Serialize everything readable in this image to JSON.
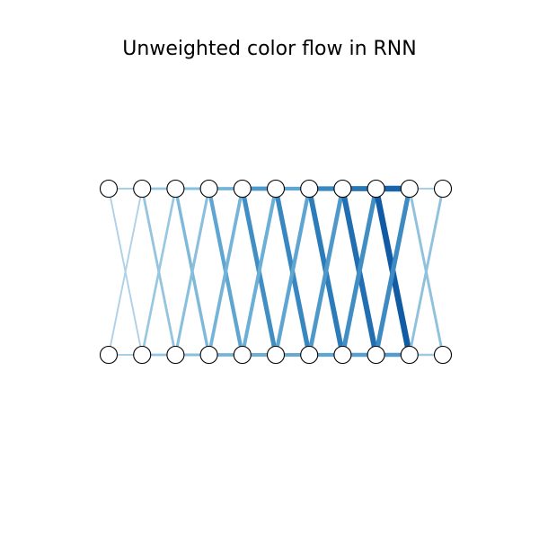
{
  "title": "Unweighted color flow in RNN",
  "diagram": {
    "node_count_per_row": 11,
    "rows": [
      "top",
      "bottom"
    ],
    "node_fill": "#ffffff",
    "node_stroke": "#000000",
    "colormap": "Blues",
    "edges": [
      {
        "from": [
          "top",
          0
        ],
        "to": [
          "top",
          1
        ],
        "level": 0.18
      },
      {
        "from": [
          "top",
          1
        ],
        "to": [
          "top",
          2
        ],
        "level": 0.28
      },
      {
        "from": [
          "top",
          2
        ],
        "to": [
          "top",
          3
        ],
        "level": 0.35
      },
      {
        "from": [
          "top",
          3
        ],
        "to": [
          "top",
          4
        ],
        "level": 0.45
      },
      {
        "from": [
          "top",
          4
        ],
        "to": [
          "top",
          5
        ],
        "level": 0.62
      },
      {
        "from": [
          "top",
          5
        ],
        "to": [
          "top",
          6
        ],
        "level": 0.55
      },
      {
        "from": [
          "top",
          6
        ],
        "to": [
          "top",
          7
        ],
        "level": 0.72
      },
      {
        "from": [
          "top",
          7
        ],
        "to": [
          "top",
          8
        ],
        "level": 0.8
      },
      {
        "from": [
          "top",
          8
        ],
        "to": [
          "top",
          9
        ],
        "level": 0.9
      },
      {
        "from": [
          "top",
          9
        ],
        "to": [
          "top",
          10
        ],
        "level": 0.18
      },
      {
        "from": [
          "bottom",
          0
        ],
        "to": [
          "bottom",
          1
        ],
        "level": 0.18
      },
      {
        "from": [
          "bottom",
          1
        ],
        "to": [
          "bottom",
          2
        ],
        "level": 0.3
      },
      {
        "from": [
          "bottom",
          2
        ],
        "to": [
          "bottom",
          3
        ],
        "level": 0.35
      },
      {
        "from": [
          "bottom",
          3
        ],
        "to": [
          "bottom",
          4
        ],
        "level": 0.45
      },
      {
        "from": [
          "bottom",
          4
        ],
        "to": [
          "bottom",
          5
        ],
        "level": 0.5
      },
      {
        "from": [
          "bottom",
          5
        ],
        "to": [
          "bottom",
          6
        ],
        "level": 0.52
      },
      {
        "from": [
          "bottom",
          6
        ],
        "to": [
          "bottom",
          7
        ],
        "level": 0.55
      },
      {
        "from": [
          "bottom",
          7
        ],
        "to": [
          "bottom",
          8
        ],
        "level": 0.58
      },
      {
        "from": [
          "bottom",
          8
        ],
        "to": [
          "bottom",
          9
        ],
        "level": 0.6
      },
      {
        "from": [
          "bottom",
          9
        ],
        "to": [
          "bottom",
          10
        ],
        "level": 0.25
      },
      {
        "from": [
          "top",
          0
        ],
        "to": [
          "bottom",
          1
        ],
        "level": 0.15
      },
      {
        "from": [
          "top",
          1
        ],
        "to": [
          "bottom",
          0
        ],
        "level": 0.15
      },
      {
        "from": [
          "top",
          1
        ],
        "to": [
          "bottom",
          2
        ],
        "level": 0.3
      },
      {
        "from": [
          "top",
          2
        ],
        "to": [
          "bottom",
          1
        ],
        "level": 0.28
      },
      {
        "from": [
          "top",
          2
        ],
        "to": [
          "bottom",
          3
        ],
        "level": 0.4
      },
      {
        "from": [
          "top",
          3
        ],
        "to": [
          "bottom",
          2
        ],
        "level": 0.35
      },
      {
        "from": [
          "top",
          3
        ],
        "to": [
          "bottom",
          4
        ],
        "level": 0.55
      },
      {
        "from": [
          "top",
          4
        ],
        "to": [
          "bottom",
          3
        ],
        "level": 0.45
      },
      {
        "from": [
          "top",
          4
        ],
        "to": [
          "bottom",
          5
        ],
        "level": 0.68
      },
      {
        "from": [
          "top",
          5
        ],
        "to": [
          "bottom",
          4
        ],
        "level": 0.5
      },
      {
        "from": [
          "top",
          5
        ],
        "to": [
          "bottom",
          6
        ],
        "level": 0.72
      },
      {
        "from": [
          "top",
          6
        ],
        "to": [
          "bottom",
          5
        ],
        "level": 0.55
      },
      {
        "from": [
          "top",
          6
        ],
        "to": [
          "bottom",
          7
        ],
        "level": 0.78
      },
      {
        "from": [
          "top",
          7
        ],
        "to": [
          "bottom",
          6
        ],
        "level": 0.62
      },
      {
        "from": [
          "top",
          7
        ],
        "to": [
          "bottom",
          8
        ],
        "level": 0.85
      },
      {
        "from": [
          "top",
          8
        ],
        "to": [
          "bottom",
          7
        ],
        "level": 0.68
      },
      {
        "from": [
          "top",
          8
        ],
        "to": [
          "bottom",
          9
        ],
        "level": 0.95
      },
      {
        "from": [
          "top",
          9
        ],
        "to": [
          "bottom",
          8
        ],
        "level": 0.7
      },
      {
        "from": [
          "top",
          9
        ],
        "to": [
          "bottom",
          10
        ],
        "level": 0.32
      },
      {
        "from": [
          "top",
          10
        ],
        "to": [
          "bottom",
          9
        ],
        "level": 0.32
      }
    ]
  }
}
